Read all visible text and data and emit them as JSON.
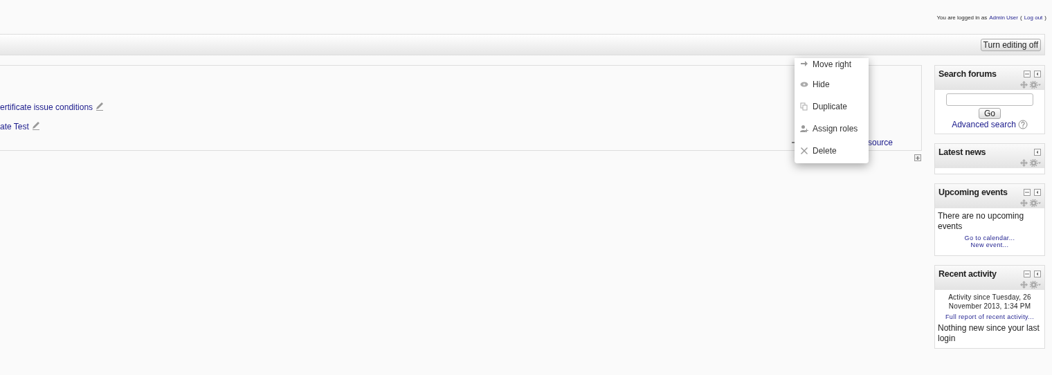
{
  "login": {
    "prefix": "You are logged in as",
    "user": "Admin User",
    "open": "(",
    "logout": "Log out",
    "close": ")"
  },
  "header": {
    "button": "Turn editing off"
  },
  "section": {
    "activities": [
      {
        "text": "ertificate issue conditions"
      },
      {
        "text": "ate Test"
      }
    ],
    "add_resource": "source"
  },
  "action_menu": [
    {
      "kind": "move",
      "label": "Move right"
    },
    {
      "kind": "hide",
      "label": "Hide"
    },
    {
      "kind": "duplicate",
      "label": "Duplicate"
    },
    {
      "kind": "roles",
      "label": "Assign roles"
    },
    {
      "kind": "delete",
      "label": "Delete"
    }
  ],
  "blocks": [
    {
      "kind": "search",
      "title": "Search forums",
      "minimize": true,
      "button": "Go",
      "link": "Advanced search"
    },
    {
      "kind": "news",
      "title": "Latest news",
      "minimize": false
    },
    {
      "kind": "events",
      "title": "Upcoming events",
      "minimize": true,
      "text": "There are no upcoming events",
      "links": [
        "Go to calendar...",
        "New event..."
      ]
    },
    {
      "kind": "activity",
      "title": "Recent activity",
      "minimize": true,
      "since": "Activity since Tuesday, 26 November 2013, 1:34 PM",
      "link": "Full report of recent activity...",
      "text": "Nothing new since your last login"
    }
  ]
}
